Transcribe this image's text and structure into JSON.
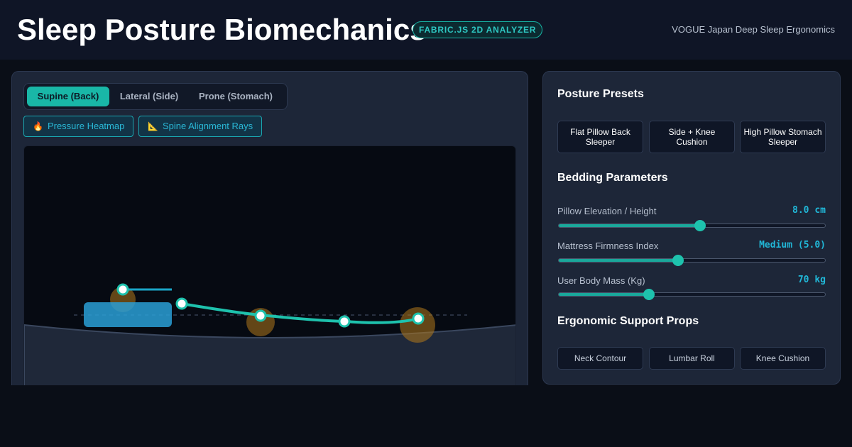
{
  "header": {
    "title": "Sleep Posture Biomechanics",
    "badge": "FABRIC.JS 2D ANALYZER",
    "subtitle": "VOGUE Japan Deep Sleep Ergonomics"
  },
  "posture_tabs": {
    "items": [
      "Supine (Back)",
      "Lateral (Side)",
      "Prone (Stomach)"
    ],
    "selected": "Supine (Back)"
  },
  "overlay_toggles": [
    {
      "label": "Pressure Heatmap",
      "icon": "fire-icon",
      "glyph": "🔥"
    },
    {
      "label": "Spine Alignment Rays",
      "icon": "triangular-ruler-icon",
      "glyph": "📐"
    }
  ],
  "posture_presets": {
    "title": "Posture Presets",
    "items": [
      "Flat Pillow Back Sleeper",
      "Side + Knee Cushion",
      "High Pillow Stomach Sleeper"
    ]
  },
  "bedding_parameters": {
    "title": "Bedding Parameters",
    "pillow": {
      "label": "Pillow Elevation / Height",
      "value_text": "8.0 cm",
      "fraction": 0.53
    },
    "firmness": {
      "label": "Mattress Firmness Index",
      "value_text": "Medium (5.0)",
      "fraction": 0.447
    },
    "mass": {
      "label": "User Body Mass (Kg)",
      "value_text": "70 kg",
      "fraction": 0.34
    }
  },
  "support_props": {
    "title": "Ergonomic Support Props",
    "items": [
      "Neck Contour",
      "Lumbar Roll",
      "Knee Cushion"
    ]
  },
  "colors": {
    "accent": "#19b7a7",
    "spine": "#1ec2ad",
    "pillow": "#2a9fd6",
    "pressure": "#b0781c",
    "mattress": "#1f2839"
  }
}
